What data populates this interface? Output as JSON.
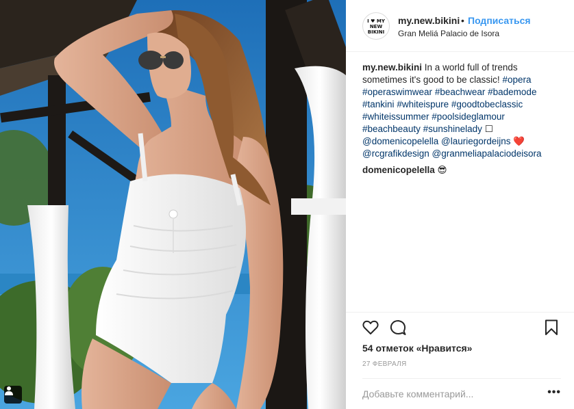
{
  "post": {
    "username": "my.new.bikini",
    "follow_separator": "•",
    "follow_label": "Подписаться",
    "location": "Gran Meliá Palacio de Isora",
    "avatar_text": [
      "I ♥ MY",
      "NEW",
      "BIKINI"
    ],
    "caption_user": "my.new.bikini",
    "caption_text": "In a world full of trends sometimes it's good to be classic!",
    "caption_hashtags": [
      "#opera",
      "#operaswimwear",
      "#beachwear",
      "#bademode",
      "#tankini",
      "#whiteispure",
      "#goodtobeclassic",
      "#whiteissummer",
      "#poolsideglamour",
      "#beachbeauty",
      "#sunshinelady"
    ],
    "caption_emoji_1": "☐",
    "caption_mentions_1": [
      "@domenicopelella",
      "@lauriegordeijns"
    ],
    "caption_emoji_2": "❤️",
    "caption_mentions_2": [
      "@rcgrafikdesign",
      "@granmeliapalaciodeisora"
    ],
    "comment_user": "domenicopelella",
    "comment_emoji": "😎"
  },
  "actions": {
    "like_icon": "heart-outline-icon",
    "comment_icon": "speech-bubble-icon",
    "save_icon": "bookmark-outline-icon"
  },
  "likes_text": "54 отметок «Нравится»",
  "date_text": "27 ФЕВРАЛЯ",
  "comment_placeholder": "Добавьте комментарий...",
  "more_label": "•••",
  "photo": {
    "description_colors": {
      "sky": "#1c78c4",
      "swimsuit": "#f4f4f4",
      "skin": "#d8a58a",
      "hair": "#8a5530",
      "pole": "#1f1a17"
    },
    "tag_icon": "person-tag-icon"
  }
}
